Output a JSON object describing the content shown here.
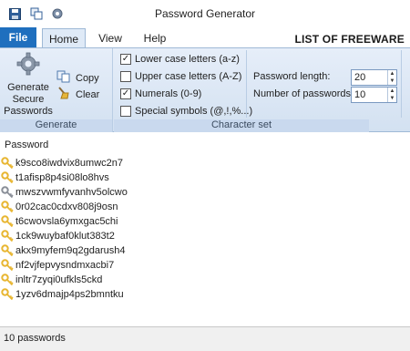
{
  "window": {
    "title": "Password Generator"
  },
  "ribbon": {
    "file_label": "File",
    "tabs": [
      "Home",
      "View",
      "Help"
    ],
    "brand": "LIST OF FREEWARE",
    "generate_group": {
      "label": "Generate",
      "generate_button": [
        "Generate",
        "Secure",
        "Passwords"
      ],
      "copy_label": "Copy",
      "clear_label": "Clear"
    },
    "charset_group": {
      "label": "Character set",
      "options": [
        {
          "label": "Lower case letters (a-z)",
          "checked": true
        },
        {
          "label": "Upper case letters (A-Z)",
          "checked": false
        },
        {
          "label": "Numerals (0-9)",
          "checked": true
        },
        {
          "label": "Special symbols (@,!,%...)",
          "checked": false
        }
      ]
    },
    "settings_group": {
      "length_label": "Password length:",
      "length_value": "20",
      "count_label": "Number of passwords:",
      "count_value": "10"
    }
  },
  "list": {
    "column_header": "Password",
    "passwords": [
      "k9sco8iwdvix8umwc2n7",
      "t1afisp8p4si08lo8hvs",
      "mwszvwmfyvanhv5olcwo",
      "0r02cac0cdxv808j9osn",
      "t6cwovsla6ymxgac5chi",
      "1ck9wuybaf0klut383t2",
      "akx9myfem9q2gdarush4",
      "nf2vjfepvysndmxacbi7",
      "inltr7zyqi0ufkls5ckd",
      "1yzv6dmajp4ps2bmntku"
    ],
    "key_colors": [
      "#e8b632",
      "#e8b632",
      "#8a8f98",
      "#e8b632",
      "#e8b632",
      "#e8b632",
      "#e8b632",
      "#e8b632",
      "#e8b632",
      "#e8b632"
    ]
  },
  "status": {
    "text": "10 passwords"
  }
}
